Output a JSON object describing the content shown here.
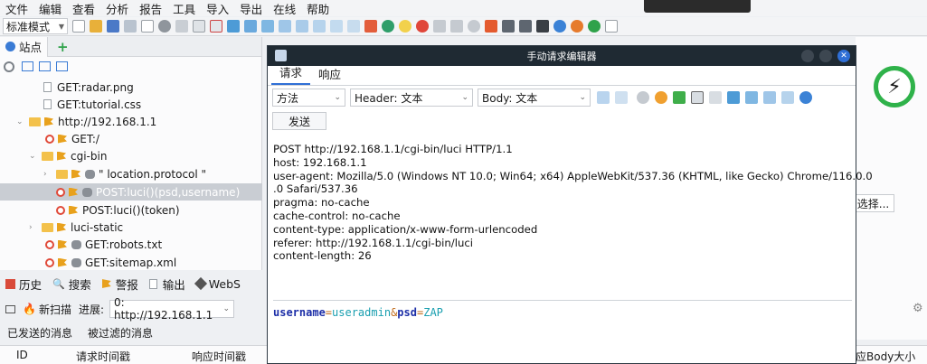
{
  "menu": [
    "文件",
    "编辑",
    "查看",
    "分析",
    "报告",
    "工具",
    "导入",
    "导出",
    "在线",
    "帮助"
  ],
  "toolbar": {
    "mode": "标准模式"
  },
  "left_panel": {
    "tab_sites": "站点",
    "tree": [
      {
        "label": "GET:radar.png"
      },
      {
        "label": "GET:tutorial.css"
      },
      {
        "label": "http://192.168.1.1"
      },
      {
        "label": "GET:/"
      },
      {
        "label": "cgi-bin"
      },
      {
        "label": "\"  location.protocol  \""
      },
      {
        "label": "POST:luci()(psd,username)"
      },
      {
        "label": "POST:luci()(token)"
      },
      {
        "label": "luci-static"
      },
      {
        "label": "GET:robots.txt"
      },
      {
        "label": "GET:sitemap.xml"
      }
    ]
  },
  "bottom": {
    "tabs": [
      "历史",
      "搜索",
      "警报",
      "输出",
      "WebS"
    ],
    "new_scan": "新扫描",
    "progress_label": "进展:",
    "progress_value": "0: http://192.168.1.1",
    "msg_tabs": [
      "已发送的消息",
      "被过滤的消息"
    ],
    "columns": [
      "ID",
      "请求时间戳",
      "响应时间戳",
      "应Body大小"
    ]
  },
  "right_partial": {
    "select_button": "选择..."
  },
  "dialog": {
    "title": "手动请求编辑器",
    "tabs": [
      "请求",
      "响应"
    ],
    "method_label": "方法",
    "header_mode": "Header: 文本",
    "body_mode": "Body: 文本",
    "send": "发送",
    "header_lines": [
      "POST http://192.168.1.1/cgi-bin/luci HTTP/1.1",
      "host: 192.168.1.1",
      "user-agent: Mozilla/5.0 (Windows NT 10.0; Win64; x64) AppleWebKit/537.36 (KHTML, like Gecko) Chrome/116.0.0",
      ".0 Safari/537.36",
      "pragma: no-cache",
      "cache-control: no-cache",
      "content-type: application/x-www-form-urlencoded",
      "referer: http://192.168.1.1/cgi-bin/luci",
      "content-length: 26"
    ],
    "body": {
      "k1": "username",
      "eq1": "=",
      "v1": "useradmin",
      "amp": "&",
      "k2": "psd",
      "eq2": "=",
      "v2": "ZAP"
    }
  },
  "colors": {
    "key": "#1d2fa8",
    "value": "#1a9fb0",
    "amp": "#c06a1a",
    "accent": "#2f6fd6",
    "title_bar": "#1f2a33"
  }
}
